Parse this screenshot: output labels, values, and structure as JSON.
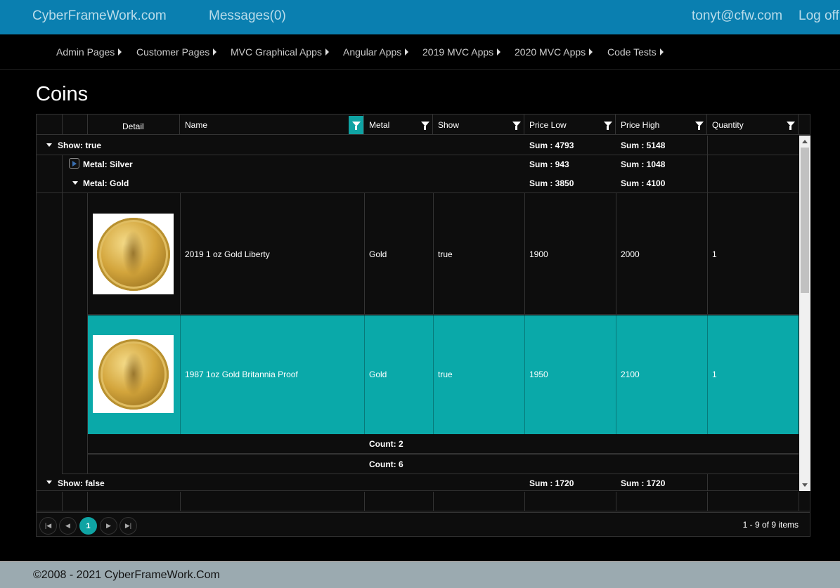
{
  "topbar": {
    "brand": "CyberFrameWork.com",
    "messages": "Messages(0)",
    "user": "tonyt@cfw.com",
    "logoff": "Log off"
  },
  "menu": [
    "Admin Pages",
    "Customer Pages",
    "MVC Graphical Apps",
    "Angular Apps",
    "2019 MVC Apps",
    "2020 MVC Apps",
    "Code Tests"
  ],
  "page_title": "Coins",
  "grid": {
    "columns": [
      "Detail",
      "Name",
      "Metal",
      "Show",
      "Price Low",
      "Price High",
      "Quantity"
    ],
    "groups": {
      "show_true": {
        "label": "Show: true",
        "sum_low": "Sum : 4793",
        "sum_high": "Sum : 5148"
      },
      "metal_silver": {
        "label": "Metal: Silver",
        "sum_low": "Sum : 943",
        "sum_high": "Sum : 1048"
      },
      "metal_gold": {
        "label": "Metal: Gold",
        "sum_low": "Sum : 3850",
        "sum_high": "Sum : 4100"
      },
      "show_false": {
        "label": "Show: false",
        "sum_low": "Sum : 1720",
        "sum_high": "Sum : 1720"
      }
    },
    "rows": [
      {
        "name": "2019 1 oz Gold Liberty",
        "metal": "Gold",
        "show": "true",
        "price_low": "1900",
        "price_high": "2000",
        "quantity": "1"
      },
      {
        "name": "1987 1oz Gold Britannia Proof",
        "metal": "Gold",
        "show": "true",
        "price_low": "1950",
        "price_high": "2100",
        "quantity": "1"
      }
    ],
    "footers": {
      "gold_count": "Count: 2",
      "show_true_count": "Count: 6"
    },
    "pager": {
      "current_page": "1",
      "info": "1 - 9 of 9 items"
    }
  },
  "footer": {
    "text": "©2008 - 2021 CyberFrameWork.Com"
  },
  "colors": {
    "navbar": "#0a7fb0",
    "accent": "#0fa3a3",
    "footer": "#9baab0"
  }
}
